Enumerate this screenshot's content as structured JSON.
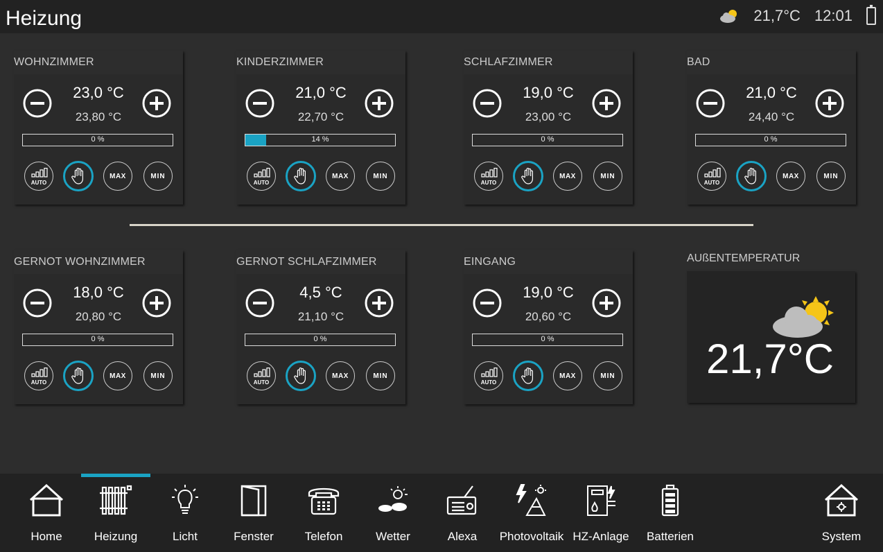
{
  "header": {
    "title": "Heizung",
    "outside_temp": "21,7°C",
    "time": "12:01"
  },
  "colors": {
    "accent": "#1aa3c4",
    "background": "#2d2d2d",
    "header": "#222222",
    "sun": "#f5c518",
    "cloud": "#bdbdbd"
  },
  "rooms": [
    {
      "name": "WOHNZIMMER",
      "setpoint": "23,0 °C",
      "actual": "23,80 °C",
      "valve": "0 %",
      "valve_fraction": 0
    },
    {
      "name": "KINDERZIMMER",
      "setpoint": "21,0 °C",
      "actual": "22,70 °C",
      "valve": "14 %",
      "valve_fraction": 0.14
    },
    {
      "name": "SCHLAFZIMMER",
      "setpoint": "19,0 °C",
      "actual": "23,00 °C",
      "valve": "0 %",
      "valve_fraction": 0
    },
    {
      "name": "BAD",
      "setpoint": "21,0 °C",
      "actual": "24,40 °C",
      "valve": "0 %",
      "valve_fraction": 0
    },
    {
      "name": "GERNOT WOHNZIMMER",
      "setpoint": "18,0 °C",
      "actual": "20,80 °C",
      "valve": "0 %",
      "valve_fraction": 0
    },
    {
      "name": "GERNOT SCHLAFZIMMER",
      "setpoint": "4,5 °C",
      "actual": "21,10 °C",
      "valve": "0 %",
      "valve_fraction": 0
    },
    {
      "name": "EINGANG",
      "setpoint": "19,0 °C",
      "actual": "20,60 °C",
      "valve": "0 %",
      "valve_fraction": 0
    }
  ],
  "modes": {
    "auto": "AUTO",
    "max": "MAX",
    "min": "MIN"
  },
  "outside": {
    "title": "AUßENTEMPERATUR",
    "temp": "21,7°C"
  },
  "nav": [
    {
      "label": "Home",
      "icon": "house-icon"
    },
    {
      "label": "Heizung",
      "icon": "radiator-icon",
      "active": true
    },
    {
      "label": "Licht",
      "icon": "bulb-icon"
    },
    {
      "label": "Fenster",
      "icon": "window-icon"
    },
    {
      "label": "Telefon",
      "icon": "telephone-icon"
    },
    {
      "label": "Wetter",
      "icon": "weather-icon"
    },
    {
      "label": "Alexa",
      "icon": "radio-icon"
    },
    {
      "label": "Photovoltaik",
      "icon": "solar-panel-icon"
    },
    {
      "label": "HZ-Anlage",
      "icon": "heating-system-icon"
    },
    {
      "label": "Batterien",
      "icon": "battery-icon"
    },
    {
      "label": "System",
      "icon": "house-gear-icon"
    }
  ]
}
